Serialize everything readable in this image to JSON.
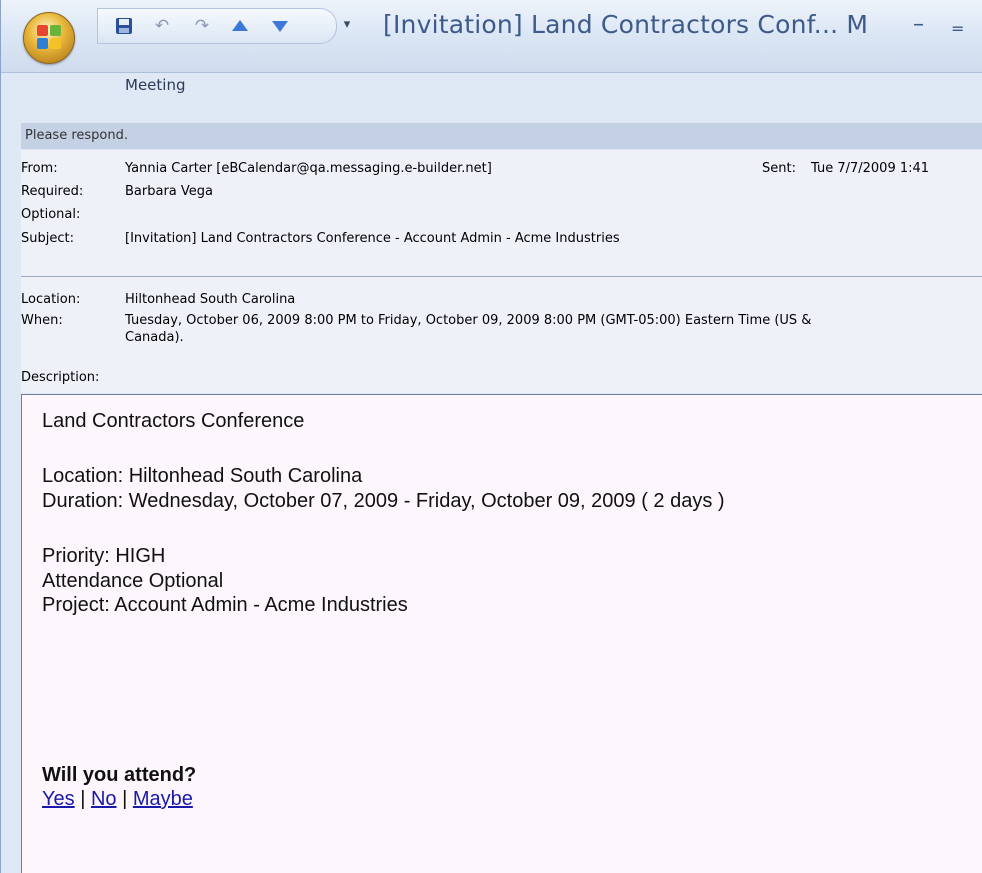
{
  "window": {
    "title": "[Invitation] Land Contractors Conf... M",
    "minimize_glyph": "–",
    "restore_glyph": "="
  },
  "quick_access": {
    "items": [
      "save-icon",
      "undo-icon",
      "redo-icon",
      "previous-item-icon",
      "next-item-icon"
    ],
    "customize_glyph": "▾"
  },
  "ribbon": {
    "active_tab": "Meeting"
  },
  "infobar": {
    "text": "Please respond."
  },
  "header": {
    "from_label": "From:",
    "from_value": "Yannia Carter [eBCalendar@qa.messaging.e-builder.net]",
    "sent_label": "Sent:",
    "sent_value": "Tue 7/7/2009 1:41",
    "required_label": "Required:",
    "required_value": "Barbara Vega",
    "optional_label": "Optional:",
    "optional_value": "",
    "subject_label": "Subject:",
    "subject_value": "[Invitation] Land Contractors Conference - Account Admin - Acme Industries",
    "location_label": "Location:",
    "location_value": "Hiltonhead South Carolina",
    "when_label": "When:",
    "when_line1": "Tuesday, October 06, 2009 8:00 PM to Friday, October 09, 2009 8:00 PM (GMT-05:00) Eastern Time (US &",
    "when_line2": "Canada).",
    "description_label": "Description:"
  },
  "body": {
    "heading": "Land Contractors Conference",
    "location_line": "Location:  Hiltonhead South Carolina",
    "duration_line": "Duration:  Wednesday, October 07, 2009 - Friday, October 09, 2009 ( 2 days )",
    "priority_line": "Priority:    HIGH",
    "attendance_line": "Attendance   Optional",
    "project_line": "Project:    Account Admin - Acme Industries",
    "question": "Will you attend?",
    "yes": "Yes",
    "no": "No",
    "maybe": "Maybe",
    "separator": " | "
  },
  "colors": {
    "title_text": "#3e5a8a",
    "link": "#1a1aa8",
    "infobar": "#c4d1e4",
    "body_bg": "#fdf7fd"
  }
}
